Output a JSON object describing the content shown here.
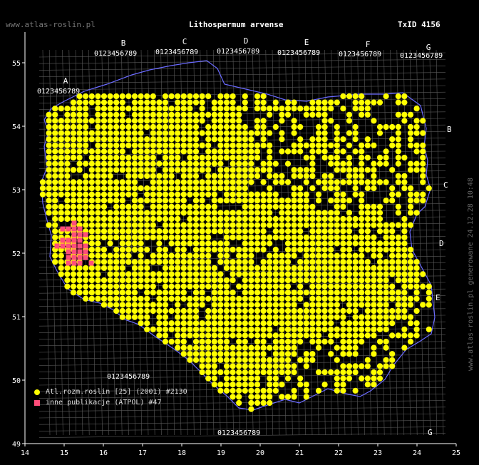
{
  "site": "www.atlas-roslin.pl",
  "title": "Lithospermum arvense",
  "txid": "TxID 4156",
  "side_note": "www.atlas-roslin.pl generowane 24.12.28 10:48",
  "axis": {
    "lon_ticks": [
      "14",
      "15",
      "16",
      "17",
      "18",
      "19",
      "20",
      "21",
      "22",
      "23",
      "24",
      "25"
    ],
    "lat_ticks": [
      "49",
      "50",
      "51",
      "52",
      "53",
      "54",
      "55"
    ]
  },
  "grid_letters": [
    "A",
    "B",
    "C",
    "D",
    "E",
    "F",
    "G"
  ],
  "grid_digits": "0123456789",
  "legend": [
    {
      "label": "Atl.rozm.roslin [25] (2001) #2130",
      "color": "#ffff00",
      "shape": "dot"
    },
    {
      "label": "inne publikacje (ATPOL) #47",
      "color": "#ff4d7a",
      "shape": "square"
    }
  ],
  "colors": {
    "occurrence": "#ffff00",
    "other": "#ff4d7a",
    "grid": "#8a8a8a",
    "border": "#6a6aff",
    "axis": "#ffffff"
  }
}
